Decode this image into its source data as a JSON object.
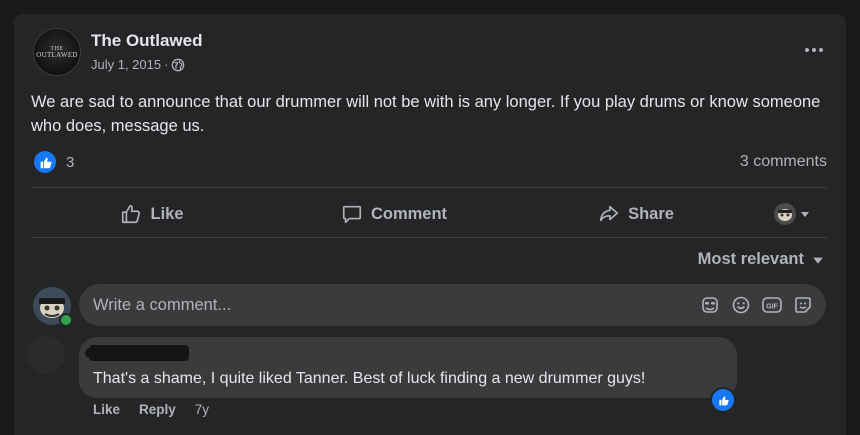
{
  "post": {
    "page_name": "The Outlawed",
    "avatar_text_line1": "THE",
    "avatar_text_line2": "OUTLAWED",
    "date": "July 1, 2015",
    "separator": "·",
    "privacy_icon": "globe-icon",
    "text": "We are sad to announce that our drummer will not be with is any longer. If you play drums or know someone who does, message us.",
    "reaction_count": "3",
    "reaction_icon": "like-thumb-icon",
    "comment_count": "3 comments"
  },
  "actions": {
    "like_label": "Like",
    "comment_label": "Comment",
    "share_label": "Share"
  },
  "comments_section": {
    "sort_label": "Most relevant",
    "input_placeholder": "Write a comment...",
    "input_icons": [
      "sticker-icon",
      "emoji-icon",
      "gif-icon",
      "avatar-sticker-icon"
    ]
  },
  "comment": {
    "text": "That's a shame, I quite liked Tanner. Best of luck finding a new drummer guys!",
    "like_label": "Like",
    "reply_label": "Reply",
    "time": "7y"
  },
  "colors": {
    "background": "#18191a",
    "card": "#242526",
    "input": "#3a3b3c",
    "accent": "#1877f2",
    "text_primary": "#e4e6eb",
    "text_secondary": "#b0b3b8",
    "online": "#31a24c"
  }
}
